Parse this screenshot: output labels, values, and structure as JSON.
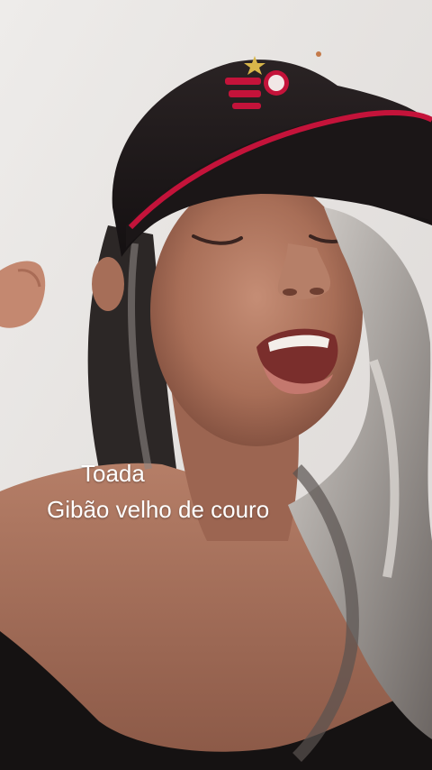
{
  "caption": {
    "line1": "Toada",
    "line2": "Gibão velho de couro"
  },
  "colors": {
    "background_wall": "#ebe9e7",
    "cap_black": "#1f1a1b",
    "cap_red_stripe": "#c4133a",
    "skin": "#b07a63",
    "hair_dark": "#2c2726",
    "hair_gray": "#b8b4b0",
    "top_black": "#151212",
    "caption_text": "#ffffff"
  },
  "scene": {
    "subject": "person-singing-selfie",
    "cap_badge": "club-crest-icon"
  }
}
